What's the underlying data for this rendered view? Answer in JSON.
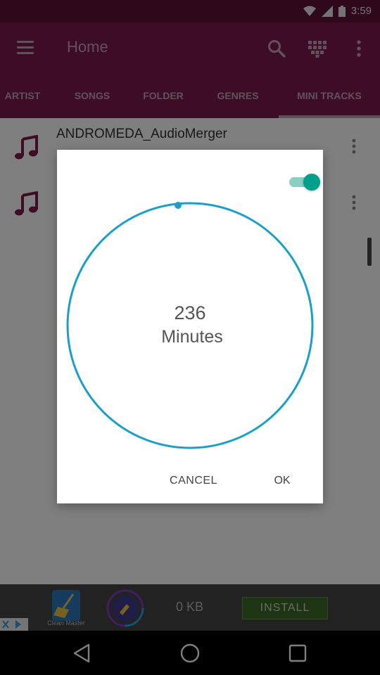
{
  "status_bar": {
    "time": "3:59"
  },
  "app_bar": {
    "title": "Home"
  },
  "tabs": [
    {
      "label": "ARTIST",
      "active": false
    },
    {
      "label": "SONGS",
      "active": false
    },
    {
      "label": "FOLDER",
      "active": false
    },
    {
      "label": "GENRES",
      "active": false
    },
    {
      "label": "MINI TRACKS",
      "active": true
    }
  ],
  "list": {
    "items": [
      {
        "title": "ANDROMEDA_AudioMerger"
      },
      {
        "title": ""
      }
    ]
  },
  "dialog": {
    "toggle_on": true,
    "timer_value": "236",
    "timer_unit": "Minutes",
    "cancel_label": "CANCEL",
    "ok_label": "OK",
    "accent_color": "#1aa0c8",
    "toggle_color": "#00a08a"
  },
  "ad": {
    "app_name": "Clean Master",
    "size_text": "0 KB",
    "install_label": "INSTALL"
  },
  "colors": {
    "primary": "#7a1a4d",
    "status_bar": "#5e1039"
  }
}
